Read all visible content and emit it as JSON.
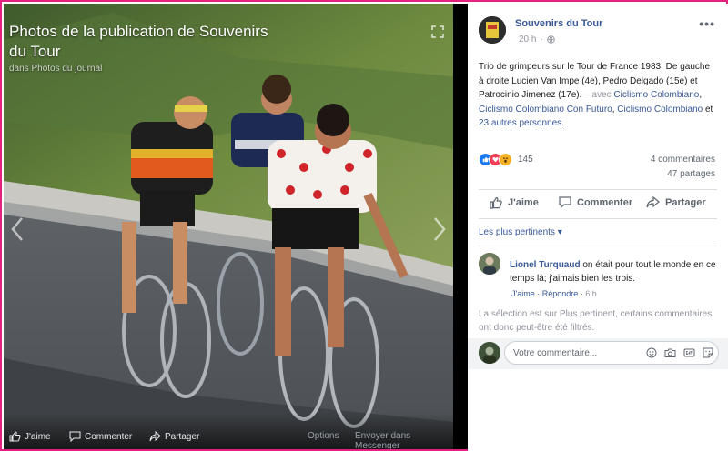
{
  "viewer": {
    "title": "Photos de la publication de Souvenirs du Tour",
    "subtitle": "dans Photos du journal",
    "bottom_actions": {
      "like": "J'aime",
      "comment": "Commenter",
      "share": "Partager",
      "options": "Options",
      "send": "Envoyer dans Messenger"
    }
  },
  "post": {
    "page_name": "Souvenirs du Tour",
    "time": "20 h",
    "more": "•••",
    "text_main": "Trio de grimpeurs sur le Tour de France 1983. De gauche à droite Lucien Van Impe (4e), Pedro Delgado (15e) et Patrocinio Jimenez (17e).",
    "with_prefix": " – avec ",
    "tag_1": "Ciclismo Colombiano",
    "sep_1": ", ",
    "tag_2": "Ciclismo Colombiano Con Futuro",
    "sep_2": ", ",
    "tag_3": "Ciclismo Colombiano",
    "and_text": " et ",
    "others": "23 autres personnes",
    "end": ".",
    "reaction_count": "145",
    "comments_count": "4 commentaires",
    "shares_count": "47 partages",
    "actions": {
      "like": "J'aime",
      "comment": "Commenter",
      "share": "Partager"
    },
    "sort_label": "Les plus pertinents ▾"
  },
  "comment": {
    "author": "Lionel Turquaud",
    "text": " on était pour tout le monde en ce temps là; j'aimais bien les trois.",
    "like": "J'aime",
    "reply": "Répondre",
    "time": "6 h"
  },
  "filter_note": "La sélection est sur Plus pertinent, certains commentaires ont donc peut-être été filtrés.",
  "composer": {
    "placeholder": "Votre commentaire..."
  },
  "colors": {
    "link": "#385898",
    "border": "#e6207e",
    "like_blue": "#1877f2",
    "love_red": "#f33e58",
    "wow_yellow": "#f7b125"
  }
}
